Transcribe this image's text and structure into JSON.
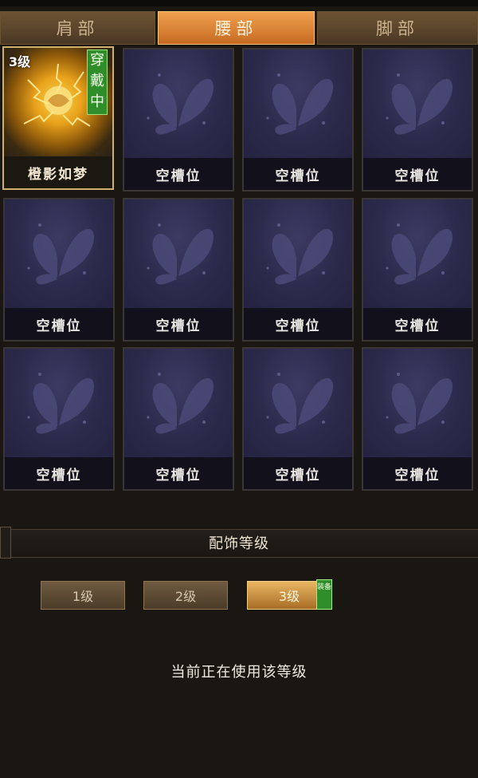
{
  "tabs": [
    {
      "label": "肩部",
      "active": false
    },
    {
      "label": "腰部",
      "active": true
    },
    {
      "label": "脚部",
      "active": false
    }
  ],
  "slots": [
    {
      "label": "橙影如梦",
      "equipped": true,
      "level": "3级",
      "status_tag": "穿戴中"
    },
    {
      "label": "空槽位"
    },
    {
      "label": "空槽位"
    },
    {
      "label": "空槽位"
    },
    {
      "label": "空槽位"
    },
    {
      "label": "空槽位"
    },
    {
      "label": "空槽位"
    },
    {
      "label": "空槽位"
    },
    {
      "label": "空槽位"
    },
    {
      "label": "空槽位"
    },
    {
      "label": "空槽位"
    },
    {
      "label": "空槽位"
    }
  ],
  "level_section": {
    "title": "配饰等级",
    "levels": [
      "1级",
      "2级",
      "3级"
    ],
    "selected_index": 2,
    "equipped_tag": "装备",
    "status_text": "当前正在使用该等级"
  },
  "colors": {
    "active_tab": "#e88f3e",
    "equipped_tag": "#2f8d2a",
    "slot_art": "#2c2a4b",
    "equipped_border": "#cfb06a"
  },
  "icons": {
    "empty_slot": "butterfly-icon",
    "equipped_item": "golden-energy-orb-icon"
  }
}
